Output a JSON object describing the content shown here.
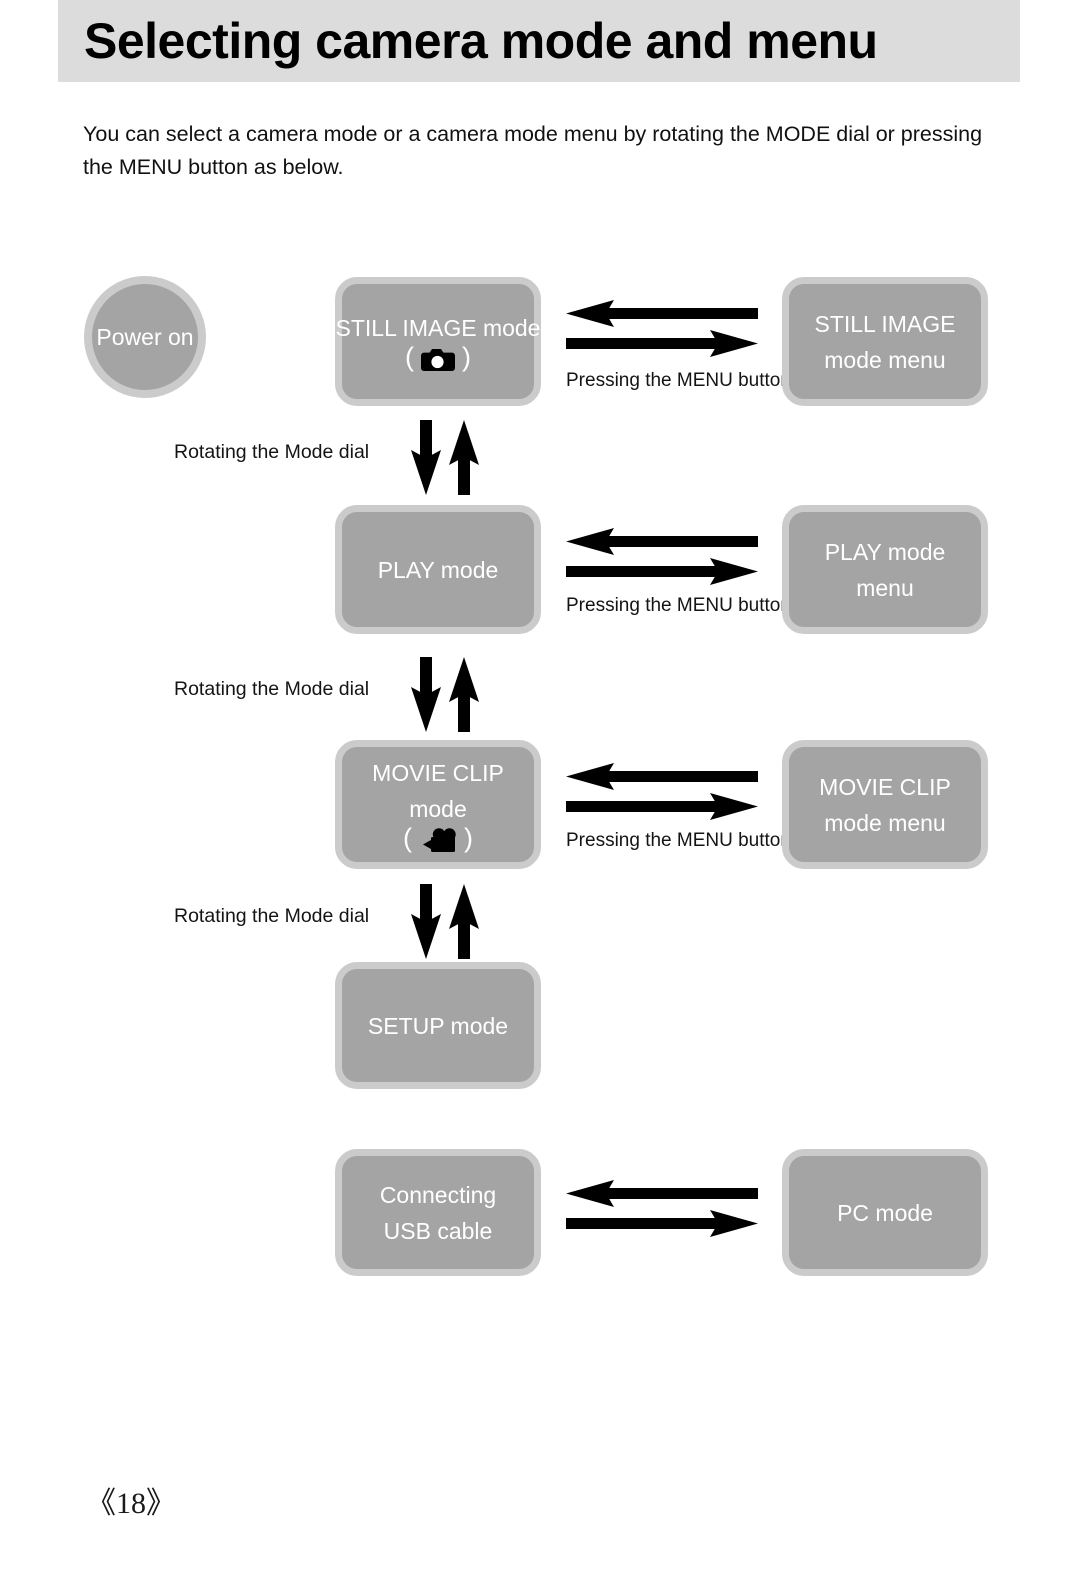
{
  "header": {
    "title": "Selecting camera mode and menu",
    "band_color": "#dcdcdc"
  },
  "intro": {
    "line1": "You can select a camera mode or a camera mode menu by rotating the MODE dial or pressing",
    "line2": "the MENU button as below."
  },
  "colors": {
    "box_fill": "#a4a4a4",
    "box_border": "#cbcbcb",
    "box_text": "#ffffff",
    "arrow": "#000000",
    "label_text": "#141414"
  },
  "diagram": {
    "type": "flowchart",
    "power_on": {
      "label": "Power on",
      "shape": "circle"
    },
    "left_column": [
      {
        "name": "still-image-mode",
        "lines": [
          "STILL IMAGE mode"
        ],
        "icon": "camera-icon",
        "icon_paren_open": "(",
        "icon_paren_close": ")"
      },
      {
        "name": "play-mode",
        "lines": [
          "PLAY mode"
        ],
        "icon": null
      },
      {
        "name": "movie-clip-mode",
        "lines": [
          "MOVIE CLIP",
          "mode"
        ],
        "icon": "movie-camera-icon",
        "icon_paren_open": "(",
        "icon_paren_close": ")"
      },
      {
        "name": "setup-mode",
        "lines": [
          "SETUP mode"
        ],
        "icon": null
      },
      {
        "name": "connecting-usb-cable",
        "lines": [
          "Connecting",
          "USB cable"
        ],
        "icon": null
      }
    ],
    "right_column": [
      {
        "name": "still-image-mode-menu",
        "lines": [
          "STILL IMAGE",
          "mode menu"
        ]
      },
      {
        "name": "play-mode-menu",
        "lines": [
          "PLAY mode",
          "menu"
        ]
      },
      {
        "name": "movie-clip-mode-menu",
        "lines": [
          "MOVIE CLIP",
          "mode menu"
        ]
      },
      {
        "name": "pc-mode",
        "lines": [
          "PC mode"
        ]
      }
    ],
    "dial_labels": [
      "Rotating the Mode dial",
      "Rotating the Mode dial",
      "Rotating the Mode dial"
    ],
    "menu_labels": [
      "Pressing the MENU button",
      "Pressing the MENU button",
      "Pressing the MENU button"
    ]
  },
  "footer": {
    "page_number": "《18》"
  }
}
